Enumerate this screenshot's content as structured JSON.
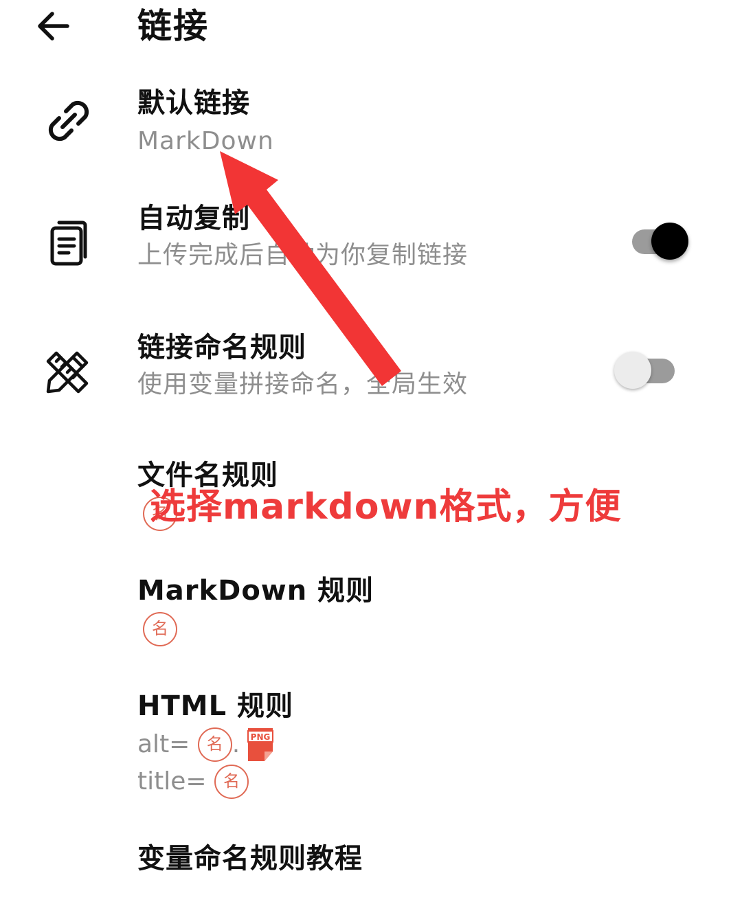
{
  "header": {
    "title": "链接"
  },
  "settings": {
    "default_link": {
      "title": "默认链接",
      "value": "MarkDown"
    },
    "auto_copy": {
      "title": "自动复制",
      "subtitle": "上传完成后自动为你复制链接",
      "enabled": true
    },
    "naming_rule": {
      "title": "链接命名规则",
      "subtitle": "使用变量拼接命名，全局生效",
      "enabled": false
    },
    "filename_rule": {
      "title": "文件名规则",
      "chip": "名"
    },
    "markdown_rule": {
      "title": "MarkDown 规则",
      "chip": "名"
    },
    "html_rule": {
      "title": "HTML 规则",
      "alt_label": "alt=",
      "alt_chip": "名",
      "dot": ".",
      "png_label": "PNG",
      "title_label": "title=",
      "title_chip": "名"
    },
    "tutorial": {
      "title": "变量命名规则教程"
    }
  },
  "annotation": {
    "text": "选择markdown格式，方便",
    "color": "#ee3b3b"
  },
  "icons": {
    "back": "arrow-left-icon",
    "default_link": "link-icon",
    "auto_copy": "copy-document-icon",
    "naming_rule": "pencil-ruler-icon",
    "png": "png-file-icon"
  },
  "colors": {
    "chip": "#e06a55",
    "subtitle": "#8e8e8e",
    "title": "#111111"
  }
}
